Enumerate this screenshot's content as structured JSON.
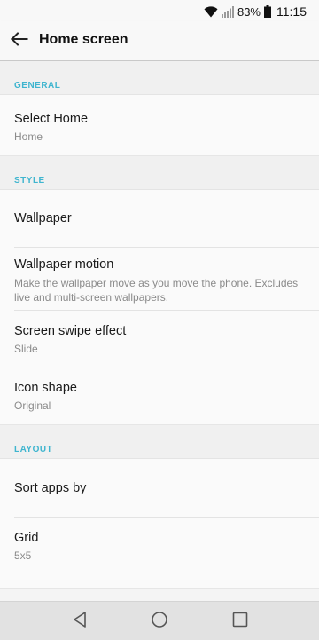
{
  "status_bar": {
    "battery_percent": "83%",
    "time": "11:15",
    "icons": [
      "wifi-icon",
      "signal-icon",
      "battery-icon"
    ]
  },
  "toolbar": {
    "back_icon": "back-arrow-icon",
    "title": "Home screen"
  },
  "sections": {
    "general": {
      "header": "GENERAL",
      "select_home": {
        "title": "Select Home",
        "subtitle": "Home"
      }
    },
    "style": {
      "header": "STYLE",
      "wallpaper": {
        "title": "Wallpaper"
      },
      "wallpaper_motion": {
        "title": "Wallpaper motion",
        "subtitle": "Make the wallpaper move as you move the phone. Excludes live and multi-screen wallpapers."
      },
      "screen_swipe_effect": {
        "title": "Screen swipe effect",
        "subtitle": "Slide"
      },
      "icon_shape": {
        "title": "Icon shape",
        "subtitle": "Original"
      }
    },
    "layout": {
      "header": "LAYOUT",
      "sort_apps_by": {
        "title": "Sort apps by"
      },
      "grid": {
        "title": "Grid",
        "subtitle": "5x5"
      }
    }
  },
  "nav_bar": {
    "icons": [
      "back-triangle-icon",
      "home-circle-icon",
      "recents-square-icon"
    ]
  },
  "colors": {
    "section_header": "#3fb5cf",
    "background": "#f4f4f4",
    "nav_bar": "#e2e2e2"
  }
}
